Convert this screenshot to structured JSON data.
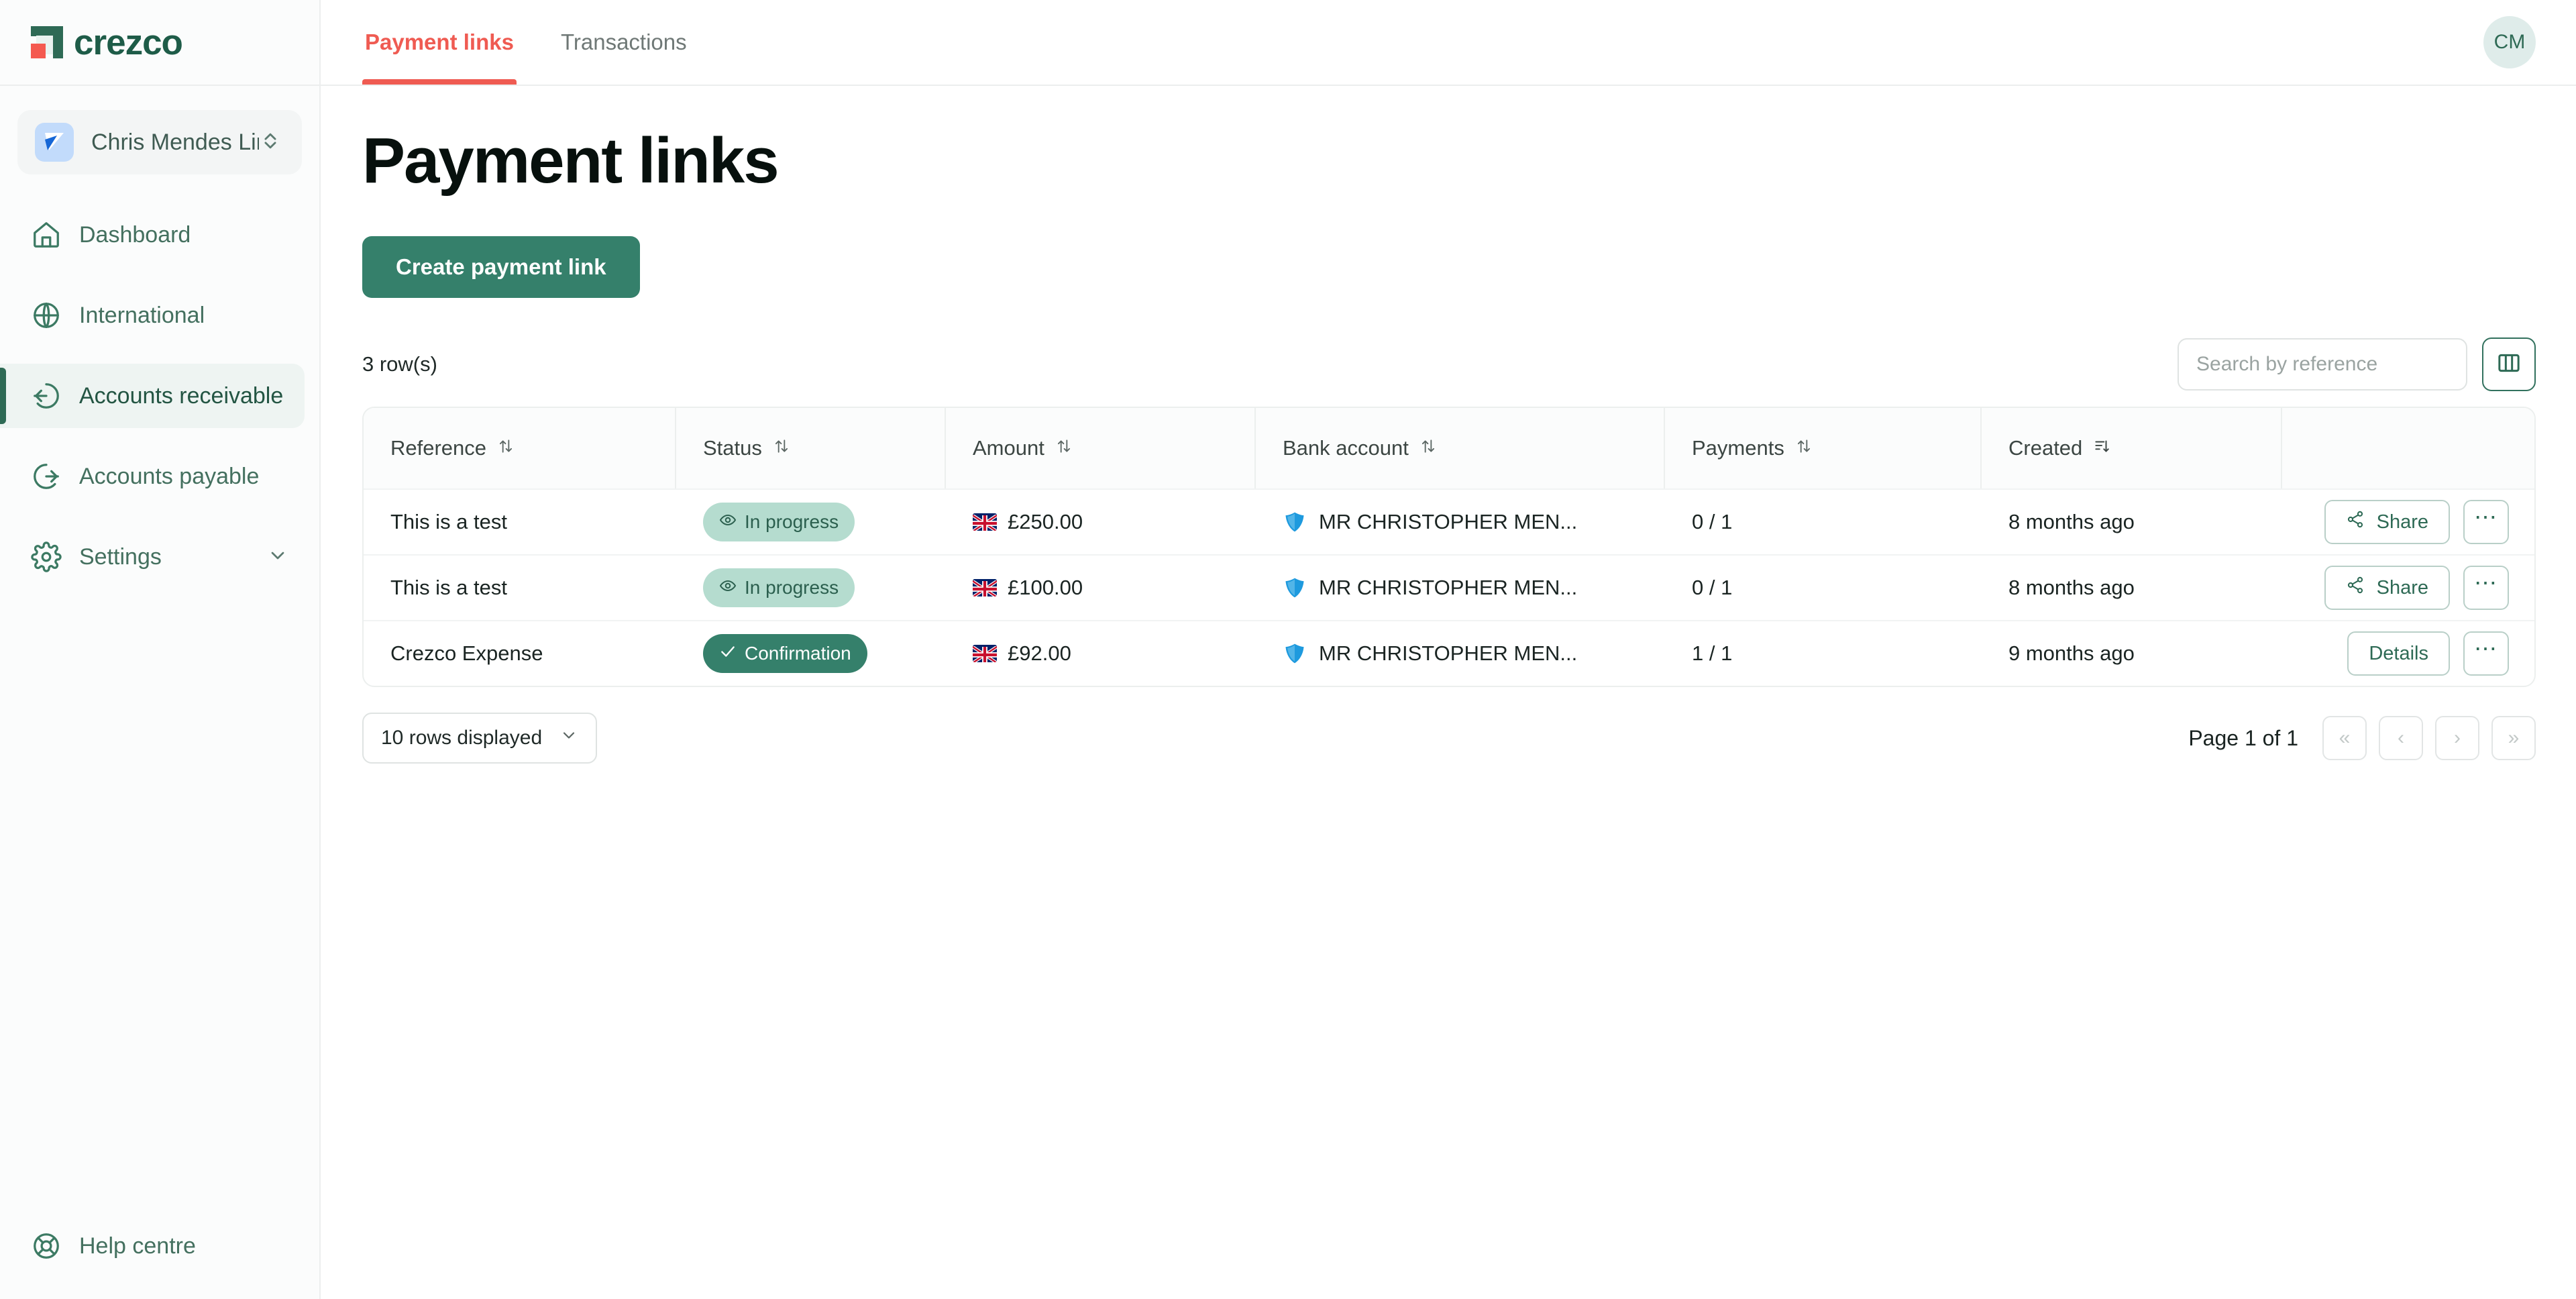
{
  "brand": {
    "name": "crezco",
    "logo_icon": "crezco-logo-icon",
    "colors": {
      "green": "#2e6a55",
      "red": "#f4594f",
      "button_green": "#35806b",
      "tab_active": "#ef5b52"
    }
  },
  "sidebar": {
    "org": {
      "name": "Chris Mendes Lim...",
      "avatar_icon": "org-avatar-icon",
      "chevron_icon": "chevron-up-down-icon"
    },
    "items": [
      {
        "label": "Dashboard",
        "icon": "home-icon",
        "active": false
      },
      {
        "label": "International",
        "icon": "globe-icon",
        "active": false
      },
      {
        "label": "Accounts receivable",
        "icon": "arrow-in-circle-icon",
        "active": true
      },
      {
        "label": "Accounts payable",
        "icon": "arrow-out-circle-icon",
        "active": false
      },
      {
        "label": "Settings",
        "icon": "gear-icon",
        "active": false,
        "chevron": "chevron-down-icon"
      }
    ],
    "footer": {
      "label": "Help centre",
      "icon": "lifebuoy-icon"
    }
  },
  "topbar": {
    "tabs": [
      {
        "label": "Payment links",
        "active": true
      },
      {
        "label": "Transactions",
        "active": false
      }
    ],
    "avatar_initials": "CM"
  },
  "main": {
    "title": "Payment links",
    "create_button": "Create payment link",
    "row_count": "3 row(s)",
    "search": {
      "placeholder": "Search by reference",
      "value": ""
    },
    "columns_button_icon": "columns-toggle-icon"
  },
  "table": {
    "headers": [
      {
        "label": "Reference",
        "sort_icon": "sort-updown-icon"
      },
      {
        "label": "Status",
        "sort_icon": "sort-updown-icon"
      },
      {
        "label": "Amount",
        "sort_icon": "sort-updown-icon"
      },
      {
        "label": "Bank account",
        "sort_icon": "sort-updown-icon"
      },
      {
        "label": "Payments",
        "sort_icon": "sort-updown-icon"
      },
      {
        "label": "Created",
        "sort_icon": "sort-descending-icon"
      }
    ],
    "rows": [
      {
        "reference": "This is a test",
        "status": "In progress",
        "status_type": "progress",
        "status_icon": "eye-icon",
        "flag": "gb-flag-icon",
        "amount": "£250.00",
        "bank_icon": "barclays-icon",
        "bank_account": "MR CHRISTOPHER MEN...",
        "payments": "0 / 1",
        "created": "8 months ago",
        "action": "Share",
        "action_icon": "share-icon",
        "more_icon": "more-horizontal-icon"
      },
      {
        "reference": "This is a test",
        "status": "In progress",
        "status_type": "progress",
        "status_icon": "eye-icon",
        "flag": "gb-flag-icon",
        "amount": "£100.00",
        "bank_icon": "barclays-icon",
        "bank_account": "MR CHRISTOPHER MEN...",
        "payments": "0 / 1",
        "created": "8 months ago",
        "action": "Share",
        "action_icon": "share-icon",
        "more_icon": "more-horizontal-icon"
      },
      {
        "reference": "Crezco Expense",
        "status": "Confirmation",
        "status_type": "confirm",
        "status_icon": "check-icon",
        "flag": "gb-flag-icon",
        "amount": "£92.00",
        "bank_icon": "barclays-icon",
        "bank_account": "MR CHRISTOPHER MEN...",
        "payments": "1 / 1",
        "created": "9 months ago",
        "action": "Details",
        "action_icon": "",
        "more_icon": "more-horizontal-icon"
      }
    ]
  },
  "footer": {
    "rows_per_page": "10 rows displayed",
    "rows_chevron_icon": "chevron-down-icon",
    "page_label": "Page 1 of 1",
    "buttons": [
      {
        "icon": "chevrons-left-icon",
        "glyph": "«"
      },
      {
        "icon": "chevron-left-icon",
        "glyph": "‹"
      },
      {
        "icon": "chevron-right-icon",
        "glyph": "›"
      },
      {
        "icon": "chevrons-right-icon",
        "glyph": "»"
      }
    ]
  }
}
